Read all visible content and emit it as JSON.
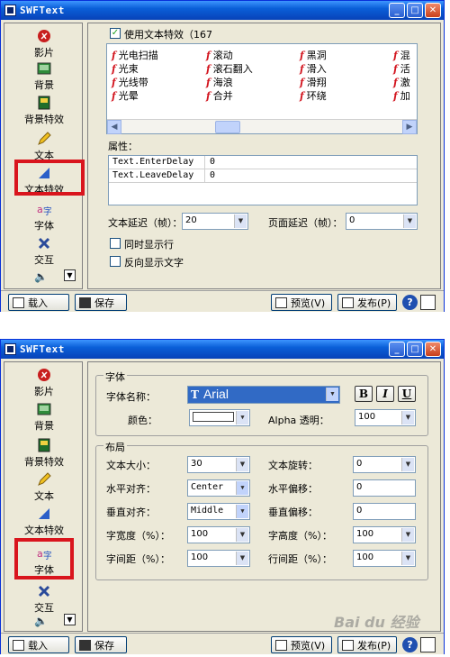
{
  "window1": {
    "title": "SWFText",
    "sidebar": [
      {
        "label": "影片",
        "icon": "film-icon"
      },
      {
        "label": "背景",
        "icon": "background-icon"
      },
      {
        "label": "背景特效",
        "icon": "background-effect-icon"
      },
      {
        "label": "文本",
        "icon": "pencil-icon"
      },
      {
        "label": "文本特效",
        "icon": "text-effect-icon"
      },
      {
        "label": "字体",
        "icon": "font-icon"
      },
      {
        "label": "交互",
        "icon": "interaction-icon"
      }
    ],
    "use_text_effect_label": "使用文本特效（167",
    "effects": [
      [
        "光电扫描",
        "滚动",
        "黑洞",
        "混"
      ],
      [
        "光束",
        "滚石翻入",
        "滑入",
        "活"
      ],
      [
        "光线带",
        "海浪",
        "滑翔",
        "激"
      ],
      [
        "光晕",
        "合并",
        "环绕",
        "加"
      ]
    ],
    "properties_label": "属性：",
    "properties": [
      {
        "key": "Text.EnterDelay",
        "value": "0"
      },
      {
        "key": "Text.LeaveDelay",
        "value": "0"
      }
    ],
    "text_delay_label": "文本延迟（帧）：",
    "text_delay_value": "20",
    "page_delay_label": "页面延迟（帧）：",
    "page_delay_value": "0",
    "show_simultaneously_label": "同时显示行",
    "reverse_display_label": "反向显示文字",
    "bottom": {
      "load": "载入",
      "save": "保存",
      "preview": "预览(V)",
      "publish": "发布(P)"
    }
  },
  "window2": {
    "title": "SWFText",
    "sidebar": [
      {
        "label": "影片",
        "icon": "film-icon"
      },
      {
        "label": "背景",
        "icon": "background-icon"
      },
      {
        "label": "背景特效",
        "icon": "background-effect-icon"
      },
      {
        "label": "文本",
        "icon": "pencil-icon"
      },
      {
        "label": "文本特效",
        "icon": "text-effect-icon"
      },
      {
        "label": "字体",
        "icon": "font-icon"
      },
      {
        "label": "交互",
        "icon": "interaction-icon"
      }
    ],
    "font_group_label": "字体",
    "font_name_label": "字体名称：",
    "font_name_value": "Arial",
    "color_label": "颜色：",
    "alpha_label": "Alpha 透明：",
    "alpha_value": "100",
    "format_buttons": [
      "B",
      "I",
      "U"
    ],
    "layout_group_label": "布局",
    "text_size_label": "文本大小：",
    "text_size_value": "30",
    "text_rotation_label": "文本旋转：",
    "text_rotation_value": "0",
    "h_align_label": "水平对齐：",
    "h_align_value": "Center",
    "h_offset_label": "水平偏移：",
    "h_offset_value": "0",
    "v_align_label": "垂直对齐：",
    "v_align_value": "Middle",
    "v_offset_label": "垂直偏移：",
    "v_offset_value": "0",
    "char_width_label": "字宽度（%）：",
    "char_width_value": "100",
    "char_height_label": "字高度（%）：",
    "char_height_value": "100",
    "char_spacing_label": "字间距（%）：",
    "char_spacing_value": "100",
    "line_spacing_label": "行间距（%）：",
    "line_spacing_value": "100",
    "bottom": {
      "load": "载入",
      "save": "保存",
      "preview": "预览(V)",
      "publish": "发布(P)"
    },
    "watermark": "Bai du 经验"
  },
  "colors": {
    "title_blue": "#0a5fd8",
    "highlight_red": "#d9151d",
    "window_bg": "#ece9d8"
  }
}
